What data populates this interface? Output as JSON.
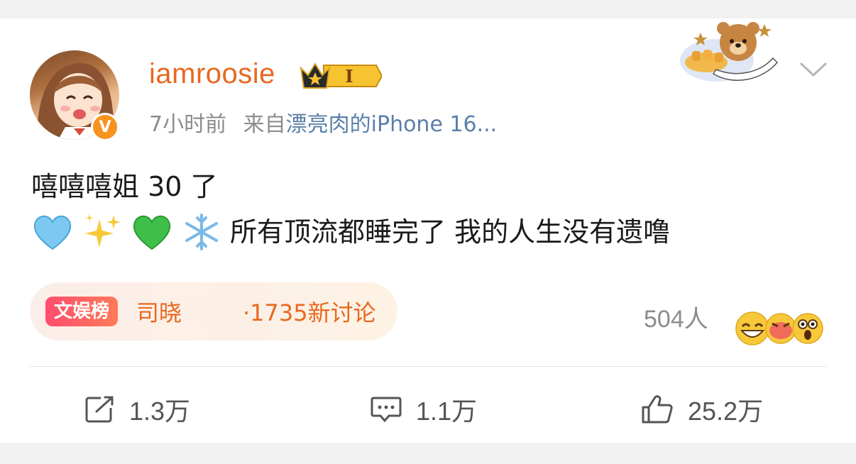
{
  "author": {
    "username": "iamroosie",
    "verified_badge": "V",
    "level_badge": "I"
  },
  "meta": {
    "time": "7小时前",
    "from_prefix": "来自",
    "source": "漂亮肉的iPhone 16..."
  },
  "post": {
    "line1": "嘻嘻嘻姐 30 了",
    "emojis": [
      "light-blue-heart",
      "sparkles",
      "green-heart",
      "snowflake"
    ],
    "line2": "所有顶流都睡完了 我的人生没有遗噜"
  },
  "topic": {
    "tag": "文娱榜",
    "name": "司晓",
    "count": "·1735新讨论"
  },
  "reactions": {
    "count": "504人",
    "faces": [
      "grin-face",
      "kiss-face",
      "shocked-face"
    ]
  },
  "actions": {
    "repost": "1.3万",
    "comment": "1.1万",
    "like": "25.2万"
  },
  "colors": {
    "username": "#e8681f",
    "source_link": "#5a7fa8",
    "meta_text": "#8c8c8c",
    "topic_tag_gradient": [
      "#ff4d6d",
      "#ff7a59"
    ]
  }
}
